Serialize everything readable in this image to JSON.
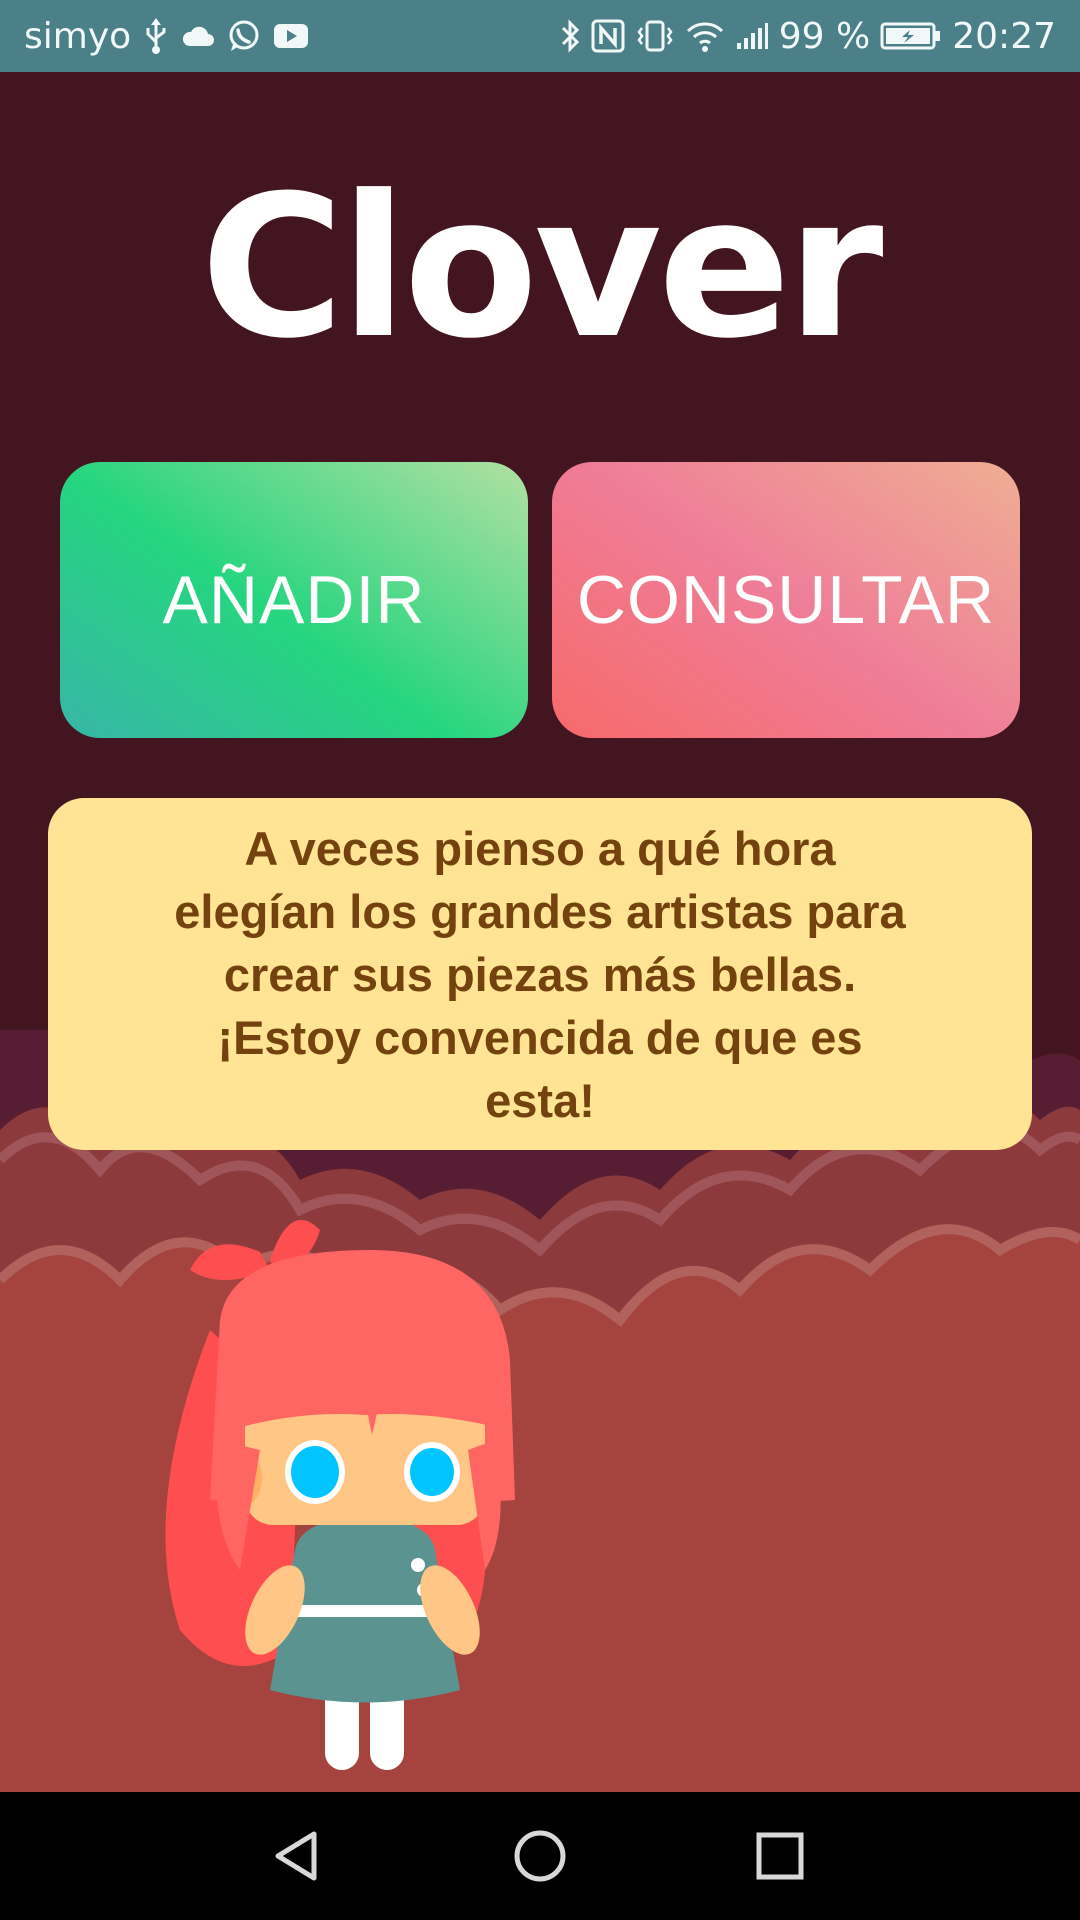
{
  "status_bar": {
    "carrier": "simyo",
    "battery_percent": "99 %",
    "time": "20:27",
    "left_icons": [
      "usb-icon",
      "cloud-icon",
      "whatsapp-icon",
      "youtube-icon"
    ],
    "right_icons": [
      "bluetooth-icon",
      "nfc-icon",
      "vibrate-icon",
      "wifi-icon",
      "signal-icon",
      "battery-charging-icon"
    ]
  },
  "app": {
    "title": "Clover"
  },
  "actions": {
    "add_label": "AÑADIR",
    "consult_label": "CONSULTAR"
  },
  "quote": {
    "text": "A veces pienso a qué hora elegían los grandes artistas para crear sus piezas más bellas. ¡Estoy convencida de que es esta!"
  },
  "nav_bar": {
    "icons": [
      "back-icon",
      "home-icon",
      "recents-icon"
    ]
  },
  "colors": {
    "background": "#421520",
    "status_bar": "#4b8088",
    "add_button_gradient": [
      "#38b6a7",
      "#25d57f",
      "#b2e0a2"
    ],
    "consult_button_gradient": [
      "#f76a6a",
      "#ef7d98",
      "#efae93"
    ],
    "quote_card": "#fee494",
    "quote_text": "#74420e"
  }
}
